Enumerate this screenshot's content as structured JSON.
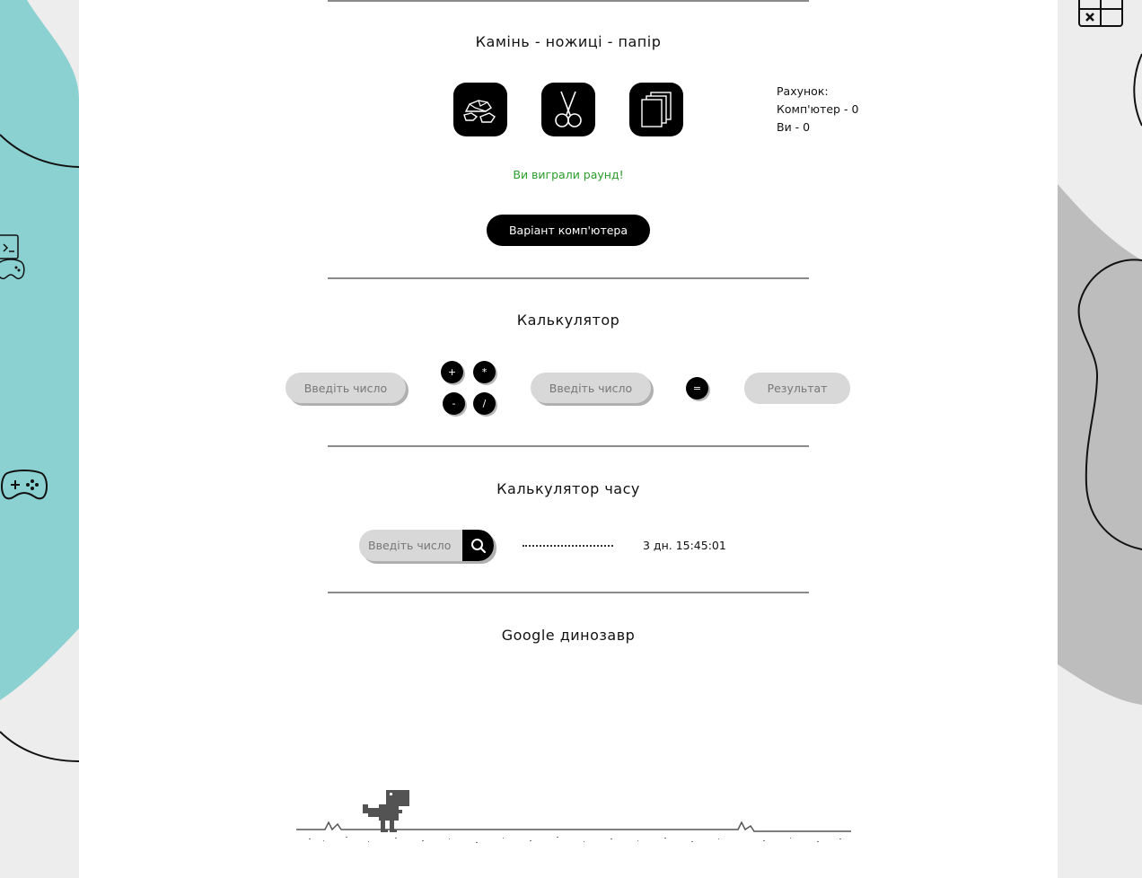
{
  "rps": {
    "title": "Камінь - ножиці - папір",
    "buttons": [
      {
        "name": "rock",
        "icon": "rock-icon"
      },
      {
        "name": "scissors",
        "icon": "scissors-icon"
      },
      {
        "name": "paper",
        "icon": "paper-icon"
      }
    ],
    "score_label": "Рахунок:",
    "computer_score": "Комп'ютер - 0",
    "user_score": "Ви - 0",
    "result_message": "Ви виграли раунд!",
    "computer_choice_button": "Варіант комп'ютера"
  },
  "calculator": {
    "title": "Калькулятор",
    "input1_placeholder": "Введіть число",
    "input2_placeholder": "Введіть число",
    "ops": [
      "+",
      "*",
      "-",
      "/"
    ],
    "equals": "=",
    "result_placeholder": "Результат"
  },
  "time_calc": {
    "title": "Калькулятор часу",
    "input_placeholder": "Введіть число",
    "output": "3 дн. 15:45:01"
  },
  "dino": {
    "title": "Google динозавр"
  },
  "colors": {
    "accent_teal": "#8cd1d1",
    "right_blob_gray": "#bdbdbd",
    "win_green": "#2a9d2a",
    "button_black": "#000000"
  }
}
